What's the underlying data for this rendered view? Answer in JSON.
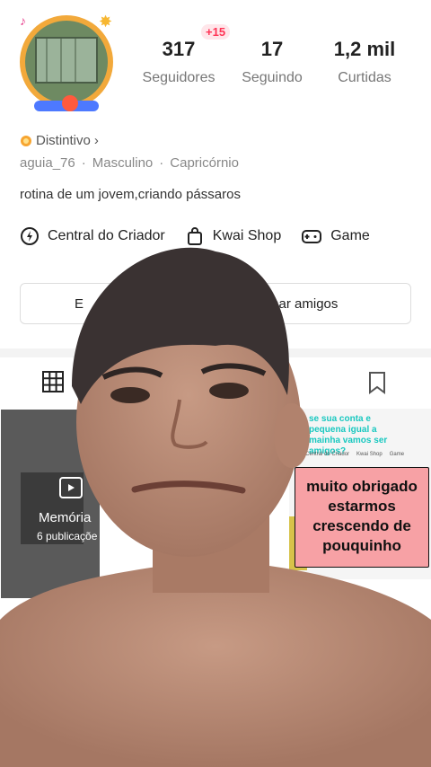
{
  "profile": {
    "stats": [
      {
        "value": "317",
        "label": "Seguidores"
      },
      {
        "value": "17",
        "label": "Seguindo"
      },
      {
        "value": "1,2 mil",
        "label": "Curtidas"
      }
    ],
    "followers_delta": "+15",
    "distintivo": "Distintivo",
    "username": "aguia_76",
    "gender": "Masculino",
    "sign": "Capricórnio",
    "separator": "·",
    "bio": "rotina de um jovem,criando pássaros"
  },
  "shortcuts": [
    {
      "label": "Central do Criador",
      "icon": "lightning-icon"
    },
    {
      "label": "Kwai Shop",
      "icon": "shopping-bag-icon"
    },
    {
      "label": "Game",
      "icon": "gamepad-icon"
    }
  ],
  "actions": {
    "edit_label": "E",
    "add_friends_label": "cionar amigos"
  },
  "posts": {
    "memory_title": "Memória",
    "memory_count": "6 publicaçõe",
    "overlay_text": "se sua conta e pequena igual a mainha vamos ser amigos?",
    "mini_shortcuts": [
      "Central do Criador",
      "Kwai Shop",
      "Game"
    ],
    "mini_bio": "rotina de um jovem,criando pássaros"
  },
  "sticker_text": "muito obrigado estarmos crescendo de pouquinho",
  "colors": {
    "accent": "#ff3355",
    "sticker_bg": "#f7a1a5",
    "overlay_text": "#19c8c0",
    "skin": "#b98a74"
  }
}
